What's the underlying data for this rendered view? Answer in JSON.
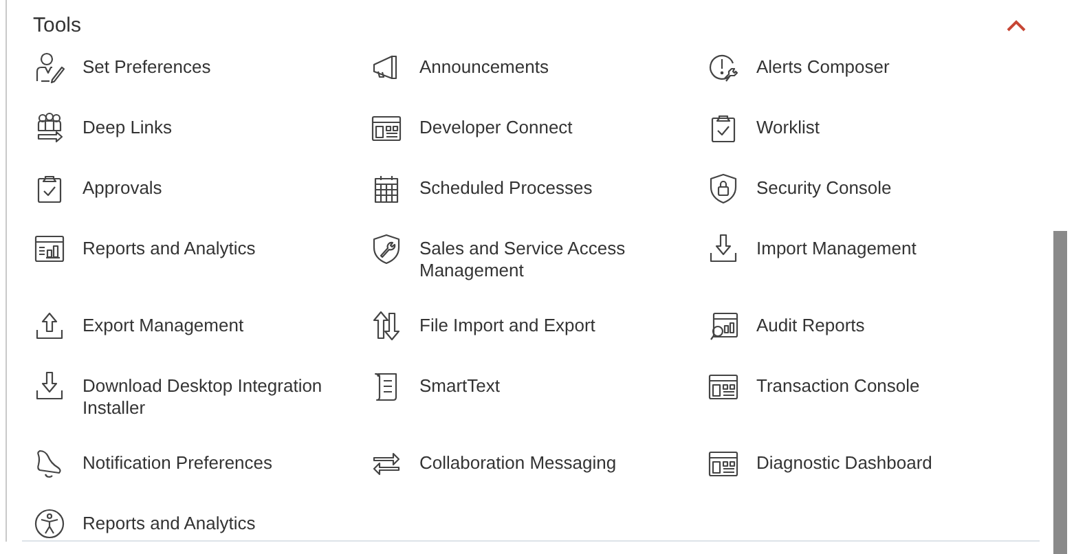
{
  "section": {
    "title": "Tools",
    "expanded": true,
    "items": [
      {
        "label": "Set Preferences",
        "kind": "person-pen"
      },
      {
        "label": "Announcements",
        "kind": "megaphone"
      },
      {
        "label": "Alerts Composer",
        "kind": "alert-wrench"
      },
      {
        "label": "Deep Links",
        "kind": "people-arrow"
      },
      {
        "label": "Developer Connect",
        "kind": "window"
      },
      {
        "label": "Worklist",
        "kind": "clipboard"
      },
      {
        "label": "Approvals",
        "kind": "clipboard"
      },
      {
        "label": "Scheduled Processes",
        "kind": "calendar"
      },
      {
        "label": "Security Console",
        "kind": "shield-lock"
      },
      {
        "label": "Reports and Analytics",
        "kind": "report"
      },
      {
        "label": "Sales and Service Access Management",
        "kind": "shield-wrench"
      },
      {
        "label": "Import Management",
        "kind": "download-tray"
      },
      {
        "label": "Export Management",
        "kind": "upload-tray"
      },
      {
        "label": "File Import and Export",
        "kind": "arrows-updown"
      },
      {
        "label": "Audit Reports",
        "kind": "report-search"
      },
      {
        "label": "Download Desktop Integration Installer",
        "kind": "download-tray"
      },
      {
        "label": "SmartText",
        "kind": "scroll"
      },
      {
        "label": "Transaction Console",
        "kind": "window"
      },
      {
        "label": "Notification Preferences",
        "kind": "bell"
      },
      {
        "label": "Collaboration Messaging",
        "kind": "arrows-swap"
      },
      {
        "label": "Diagnostic Dashboard",
        "kind": "window"
      },
      {
        "label": "Reports and Analytics",
        "kind": "accessibility"
      }
    ]
  }
}
